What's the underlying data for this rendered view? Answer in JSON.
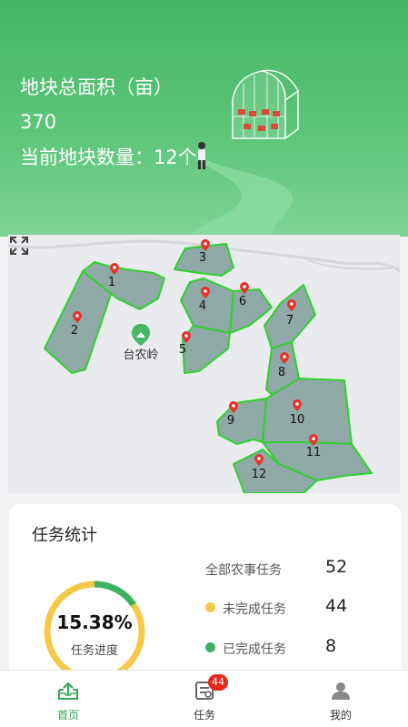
{
  "header": {
    "area_title": "地块总面积（亩）",
    "area_value": "370",
    "plot_count_text": "当前地块数量：12个"
  },
  "map": {
    "place_label": "台农岭",
    "plot_labels": [
      "1",
      "2",
      "3",
      "4",
      "5",
      "6",
      "7",
      "8",
      "9",
      "10",
      "11",
      "12"
    ],
    "plot_fill": "#8fa9a6",
    "plot_stroke": "#2fd12f"
  },
  "stats": {
    "title": "任务统计",
    "progress_pct": "15.38%",
    "progress_label": "任务进度",
    "progress_fraction": 0.1538,
    "rows": [
      {
        "label": "全部农事任务",
        "value": "52"
      },
      {
        "label": "未完成任务",
        "value": "44"
      },
      {
        "label": "已完成任务",
        "value": "8"
      }
    ],
    "colors": {
      "pending": "#f5c84a",
      "done": "#3bb263"
    }
  },
  "tabs": [
    {
      "label": "首页",
      "icon": "home-upload-icon"
    },
    {
      "label": "任务",
      "icon": "task-list-icon",
      "badge": "44"
    },
    {
      "label": "我的",
      "icon": "user-icon"
    }
  ],
  "colors": {
    "accent": "#3aa857",
    "badge": "#e8281f"
  }
}
